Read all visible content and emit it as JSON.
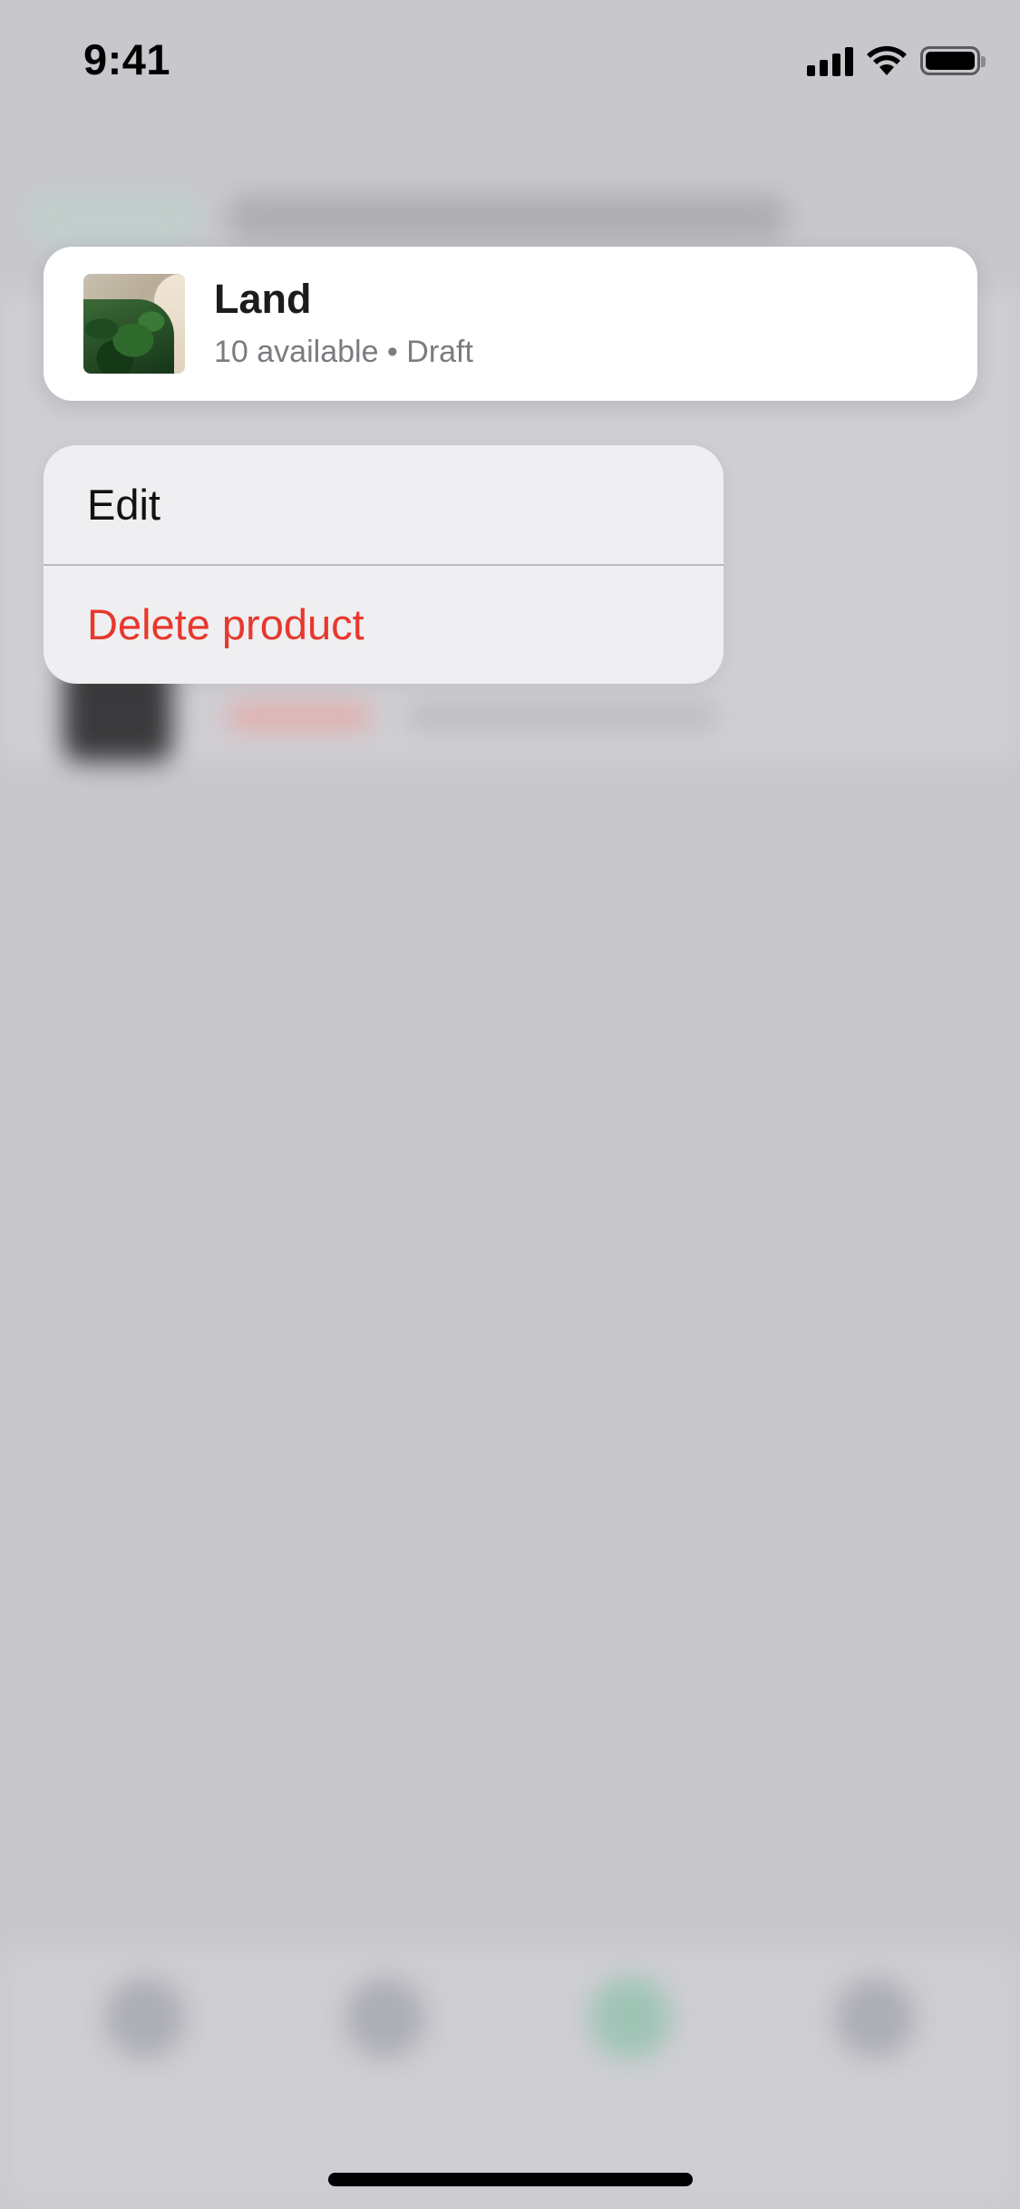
{
  "status_bar": {
    "time": "9:41",
    "icons": [
      "cellular-signal-icon",
      "wifi-icon",
      "battery-icon"
    ]
  },
  "product_card": {
    "title": "Land",
    "meta": "10 available • Draft",
    "thumbnail": "product-thumbnail-image"
  },
  "context_menu": {
    "items": [
      {
        "label": "Edit",
        "color": "#111111"
      },
      {
        "label": "Delete product",
        "color": "#E8382D"
      }
    ]
  },
  "colors": {
    "background_dim": "#C8C7CC",
    "card": "#FFFFFF",
    "menu": "#EFEFF1",
    "destructive": "#E8382D"
  }
}
